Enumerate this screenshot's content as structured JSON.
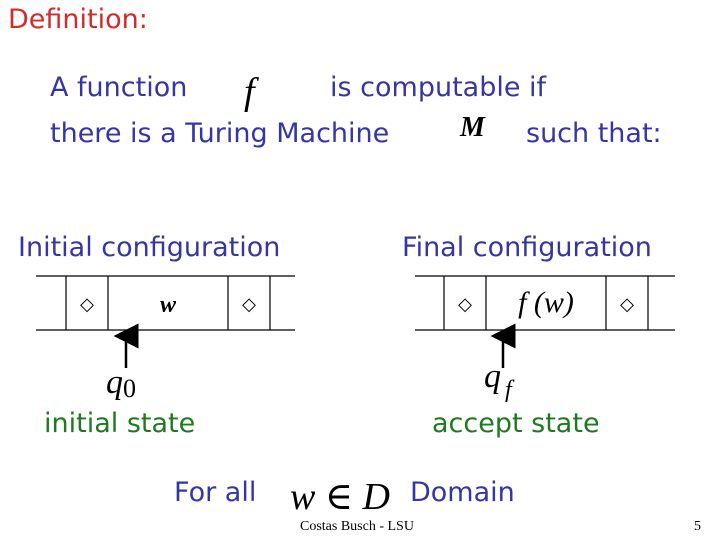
{
  "slide": {
    "title": "Definition:",
    "statement": {
      "line1_prefix": "A function",
      "function_symbol": "f",
      "line1_suffix": "is computable if",
      "line2_prefix": "there is a Turing Machine",
      "machine_symbol": "M",
      "line2_suffix": "such that:"
    },
    "initial": {
      "heading": "Initial configuration",
      "tape_cells": [
        "◇",
        "w",
        "◇"
      ],
      "state_symbol": "q",
      "state_subscript": "0",
      "state_label": "initial state"
    },
    "final": {
      "heading": "Final configuration",
      "tape_cells": [
        "◇",
        "f (w)",
        "◇"
      ],
      "state_symbol": "q",
      "state_subscript": "f",
      "state_label": "accept state"
    },
    "quantifier": {
      "prefix": "For all",
      "expression": "w ∈ D",
      "suffix": "Domain"
    },
    "footer": "Costas Busch - LSU",
    "page_number": "5"
  },
  "colors": {
    "title": "#d42a2a",
    "body_text": "#3535a6",
    "state_labels": "#1f7a1f",
    "math": "#000000"
  }
}
